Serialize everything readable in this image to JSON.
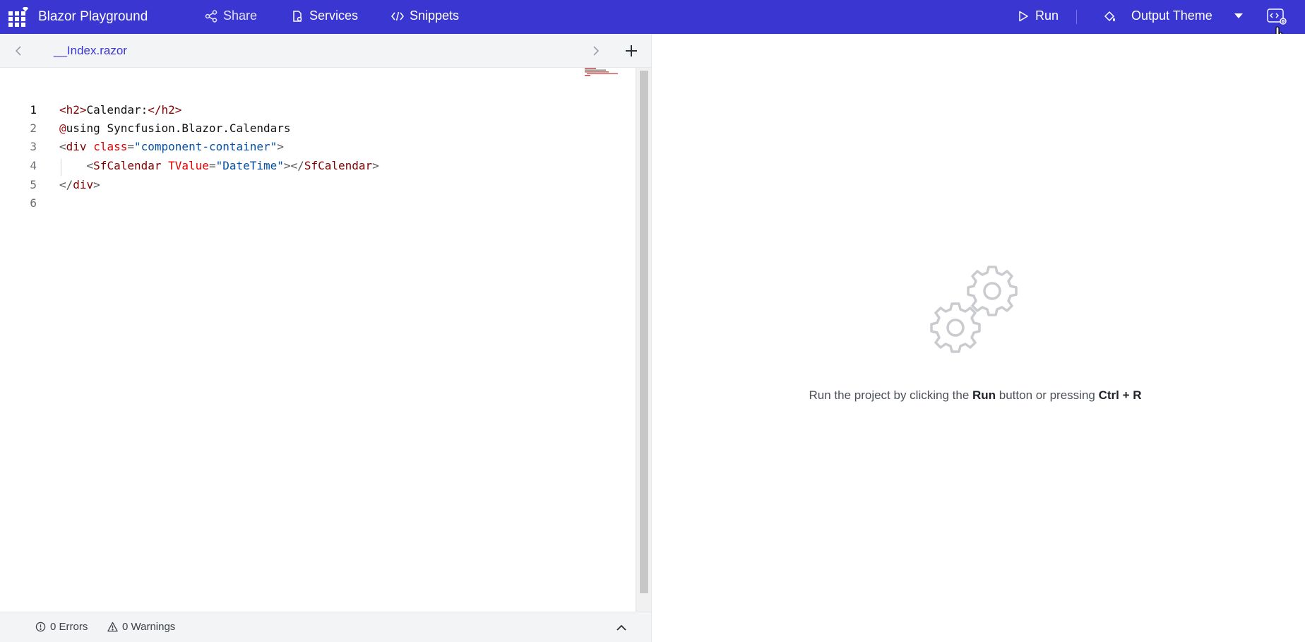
{
  "header": {
    "title": "Blazor Playground",
    "nav": {
      "share": "Share",
      "services": "Services",
      "snippets": "Snippets"
    },
    "run": "Run",
    "theme": "Output Theme",
    "icons": {
      "logo": "grid-icon",
      "share": "share-icon",
      "services": "services-icon",
      "snippets": "code-icon",
      "run": "play-icon",
      "theme": "paint-bucket-icon",
      "settings": "code-settings-icon"
    }
  },
  "editor": {
    "tab": "__Index.razor",
    "lines": [
      {
        "num": "1",
        "active": true
      },
      {
        "num": "2"
      },
      {
        "num": "3"
      },
      {
        "num": "4"
      },
      {
        "num": "5"
      },
      {
        "num": "6"
      }
    ],
    "code": {
      "l1": {
        "open": "<h2>",
        "text": "Calendar:",
        "close": "</h2>"
      },
      "l2": {
        "at": "@",
        "text": "using Syncfusion.Blazor.Calendars"
      },
      "l3": {
        "lt": "<",
        "tag": "div",
        "attr": "class",
        "eq": "=",
        "val": "\"component-container\"",
        "gt": ">"
      },
      "l4": {
        "lt": "<",
        "tag": "SfCalendar",
        "attr": "TValue",
        "eq": "=",
        "val": "\"DateTime\"",
        "mid": "></",
        "tag2": "SfCalendar",
        "gt": ">"
      },
      "l5": {
        "lt": "</",
        "tag": "div",
        "gt": ">"
      }
    }
  },
  "status": {
    "errors": "0 Errors",
    "warnings": "0 Warnings"
  },
  "output": {
    "hint_prefix": "Run the project by clicking the ",
    "hint_run": "Run",
    "hint_middle": " button or pressing ",
    "hint_shortcut": "Ctrl + R"
  },
  "colors": {
    "header_bg": "#3a36d1",
    "tab_text": "#3a36d1",
    "tag": "#800000",
    "attribute": "#e50000",
    "string": "#0451a5"
  }
}
